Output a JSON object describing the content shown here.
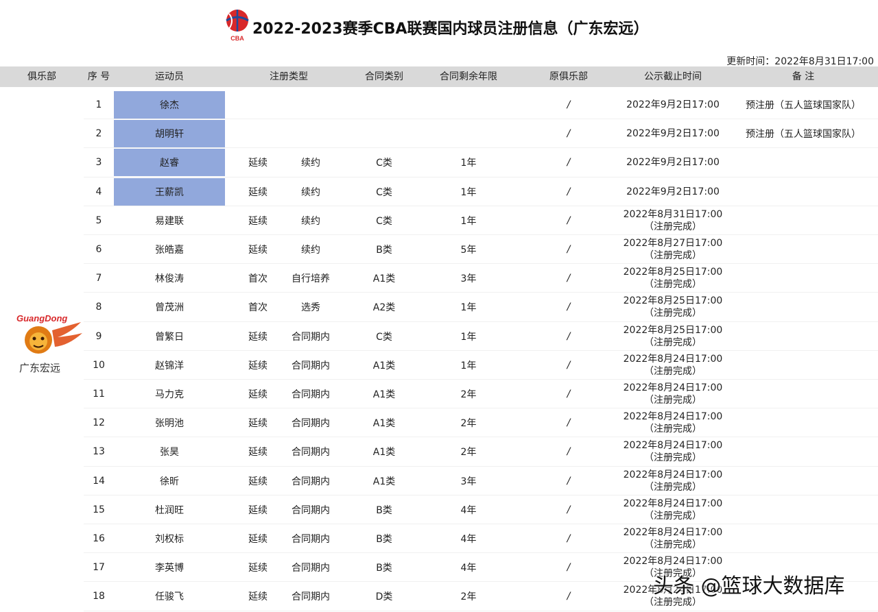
{
  "title": "2022-2023赛季CBA联赛国内球员注册信息（广东宏远）",
  "logo_text": "CBA",
  "update_time": "更新时间：2022年8月31日17:00",
  "headers": [
    "俱乐部",
    "序 号",
    "运动员",
    "注册类型",
    "合同类别",
    "合同剩余年限",
    "原俱乐部",
    "公示截止时间",
    "备 注"
  ],
  "club": {
    "name": "广东宏远",
    "logo_text": "GuangDong"
  },
  "rows": [
    {
      "no": "1",
      "name": "徐杰",
      "type1": "",
      "type2": "",
      "category": "",
      "years": "",
      "former": "/",
      "deadline1": "2022年9月2日17:00",
      "deadline2": "",
      "note": "预注册（五人篮球国家队）",
      "highlight": true
    },
    {
      "no": "2",
      "name": "胡明轩",
      "type1": "",
      "type2": "",
      "category": "",
      "years": "",
      "former": "/",
      "deadline1": "2022年9月2日17:00",
      "deadline2": "",
      "note": "预注册（五人篮球国家队）",
      "highlight": true
    },
    {
      "no": "3",
      "name": "赵睿",
      "type1": "延续",
      "type2": "续约",
      "category": "C类",
      "years": "1年",
      "former": "/",
      "deadline1": "2022年9月2日17:00",
      "deadline2": "",
      "note": "",
      "highlight": true
    },
    {
      "no": "4",
      "name": "王薪凯",
      "type1": "延续",
      "type2": "续约",
      "category": "C类",
      "years": "1年",
      "former": "/",
      "deadline1": "2022年9月2日17:00",
      "deadline2": "",
      "note": "",
      "highlight": true
    },
    {
      "no": "5",
      "name": "易建联",
      "type1": "延续",
      "type2": "续约",
      "category": "C类",
      "years": "1年",
      "former": "/",
      "deadline1": "2022年8月31日17:00",
      "deadline2": "（注册完成）",
      "note": "",
      "highlight": false
    },
    {
      "no": "6",
      "name": "张皓嘉",
      "type1": "延续",
      "type2": "续约",
      "category": "B类",
      "years": "5年",
      "former": "/",
      "deadline1": "2022年8月27日17:00",
      "deadline2": "（注册完成）",
      "note": "",
      "highlight": false
    },
    {
      "no": "7",
      "name": "林俊涛",
      "type1": "首次",
      "type2": "自行培养",
      "category": "A1类",
      "years": "3年",
      "former": "/",
      "deadline1": "2022年8月25日17:00",
      "deadline2": "（注册完成）",
      "note": "",
      "highlight": false
    },
    {
      "no": "8",
      "name": "曾茂洲",
      "type1": "首次",
      "type2": "选秀",
      "category": "A2类",
      "years": "1年",
      "former": "/",
      "deadline1": "2022年8月25日17:00",
      "deadline2": "（注册完成）",
      "note": "",
      "highlight": false
    },
    {
      "no": "9",
      "name": "曾繁日",
      "type1": "延续",
      "type2": "合同期内",
      "category": "C类",
      "years": "1年",
      "former": "/",
      "deadline1": "2022年8月25日17:00",
      "deadline2": "（注册完成）",
      "note": "",
      "highlight": false
    },
    {
      "no": "10",
      "name": "赵锦洋",
      "type1": "延续",
      "type2": "合同期内",
      "category": "A1类",
      "years": "1年",
      "former": "/",
      "deadline1": "2022年8月24日17:00",
      "deadline2": "（注册完成）",
      "note": "",
      "highlight": false
    },
    {
      "no": "11",
      "name": "马力克",
      "type1": "延续",
      "type2": "合同期内",
      "category": "A1类",
      "years": "2年",
      "former": "/",
      "deadline1": "2022年8月24日17:00",
      "deadline2": "（注册完成）",
      "note": "",
      "highlight": false
    },
    {
      "no": "12",
      "name": "张明池",
      "type1": "延续",
      "type2": "合同期内",
      "category": "A1类",
      "years": "2年",
      "former": "/",
      "deadline1": "2022年8月24日17:00",
      "deadline2": "（注册完成）",
      "note": "",
      "highlight": false
    },
    {
      "no": "13",
      "name": "张昊",
      "type1": "延续",
      "type2": "合同期内",
      "category": "A1类",
      "years": "2年",
      "former": "/",
      "deadline1": "2022年8月24日17:00",
      "deadline2": "（注册完成）",
      "note": "",
      "highlight": false
    },
    {
      "no": "14",
      "name": "徐昕",
      "type1": "延续",
      "type2": "合同期内",
      "category": "A1类",
      "years": "3年",
      "former": "/",
      "deadline1": "2022年8月24日17:00",
      "deadline2": "（注册完成）",
      "note": "",
      "highlight": false
    },
    {
      "no": "15",
      "name": "杜润旺",
      "type1": "延续",
      "type2": "合同期内",
      "category": "B类",
      "years": "4年",
      "former": "/",
      "deadline1": "2022年8月24日17:00",
      "deadline2": "（注册完成）",
      "note": "",
      "highlight": false
    },
    {
      "no": "16",
      "name": "刘权标",
      "type1": "延续",
      "type2": "合同期内",
      "category": "B类",
      "years": "4年",
      "former": "/",
      "deadline1": "2022年8月24日17:00",
      "deadline2": "（注册完成）",
      "note": "",
      "highlight": false
    },
    {
      "no": "17",
      "name": "李英博",
      "type1": "延续",
      "type2": "合同期内",
      "category": "B类",
      "years": "4年",
      "former": "/",
      "deadline1": "2022年8月24日17:00",
      "deadline2": "（注册完成）",
      "note": "",
      "highlight": false
    },
    {
      "no": "18",
      "name": "任骏飞",
      "type1": "延续",
      "type2": "合同期内",
      "category": "D类",
      "years": "2年",
      "former": "/",
      "deadline1": "2022年8月24日17:00",
      "deadline2": "（注册完成）",
      "note": "",
      "highlight": false
    }
  ],
  "watermark": "头条 @篮球大数据库",
  "colors": {
    "header_bg": "#d9d9d9",
    "highlight": "#91a8dc",
    "logo_red": "#d8282a",
    "logo_blue": "#1f4a9c"
  }
}
